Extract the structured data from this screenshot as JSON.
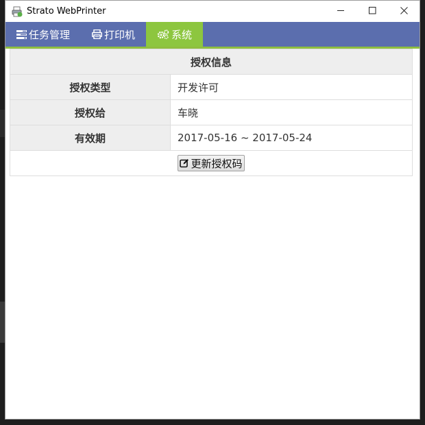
{
  "window": {
    "title": "Strato WebPrinter",
    "minimize_icon": "minimize-icon",
    "maximize_icon": "maximize-icon",
    "close_icon": "close-icon"
  },
  "nav": {
    "items": [
      {
        "label": "任务管理",
        "icon": "tasks-icon",
        "active": false
      },
      {
        "label": "打印机",
        "icon": "printer-icon",
        "active": false
      },
      {
        "label": "系统",
        "icon": "cogs-icon",
        "active": true
      }
    ],
    "colors": {
      "bar": "#5b6eae",
      "active": "#8dc63f"
    }
  },
  "license": {
    "header": "授权信息",
    "rows": [
      {
        "label": "授权类型",
        "value": "开发许可"
      },
      {
        "label": "授权给",
        "value": "车晓"
      },
      {
        "label": "有效期",
        "value": "2017-05-16 ~ 2017-05-24"
      }
    ],
    "update_button": {
      "label": "更新授权码",
      "icon": "edit-icon"
    }
  }
}
